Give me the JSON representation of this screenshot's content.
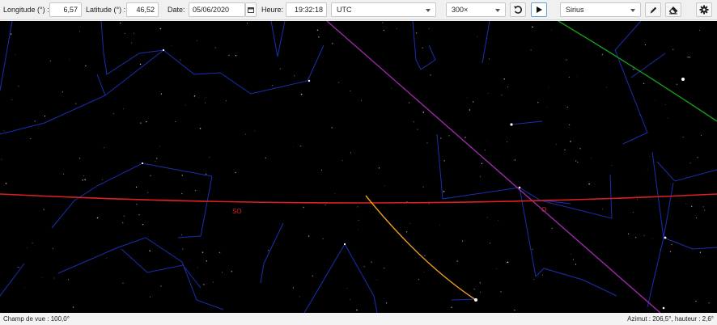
{
  "toolbar": {
    "longitude_label": "Longitude (°) :",
    "longitude_value": "6,57",
    "latitude_label": "Latitude (°) :",
    "latitude_value": "46,52",
    "date_label": "Date:",
    "date_value": "05/06/2020",
    "time_label": "Heure:",
    "time_value": "19:32:18",
    "timezone_value": "UTC",
    "speed_value": "300×",
    "target_value": "Sirius"
  },
  "sky": {
    "cardinal_southwest": "SO",
    "cardinal_west": "O",
    "horizon_color": "#e02020",
    "constellation_color": "#1a2fb0",
    "ecliptic_color": "#9b2aa8",
    "orbit_color": "#f0a020",
    "meridian_color": "#1a9a1a"
  },
  "status": {
    "field_of_view": "Champ de vue : 100,0°",
    "pointer_position": "Azimut : 206,5°, hauteur : 2,6°"
  }
}
